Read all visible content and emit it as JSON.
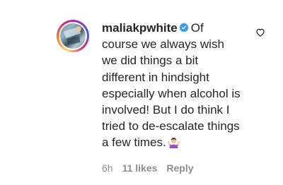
{
  "comment": {
    "username": "maliakpwhite",
    "verified_icon": "verified-badge-icon",
    "text": "Of course we always wish we did things a bit different in hindsight especially when alcohol is involved! But I do think I tried to de-escalate things a few times.",
    "emoji": "shrug-emoji-icon",
    "time": "6h",
    "likes": "11 likes",
    "reply_label": "Reply",
    "like_icon": "heart-outline-icon"
  },
  "colors": {
    "verified_blue": "#3897f0",
    "meta_gray": "#8e8e8e",
    "text": "#262626"
  }
}
